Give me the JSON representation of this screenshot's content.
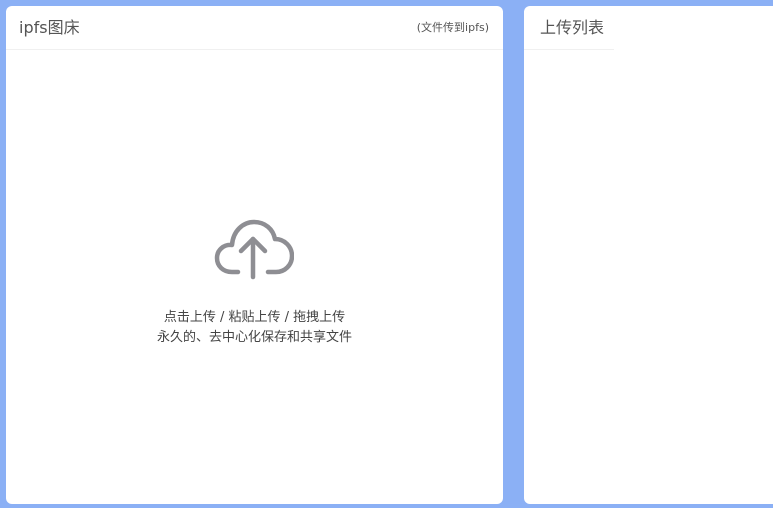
{
  "upload_panel": {
    "title": "ipfs图床",
    "note": "(文件传到ipfs)",
    "icon": "cloud-upload-icon",
    "instructions": "点击上传 / 粘贴上传 / 拖拽上传",
    "description": "永久的、去中心化保存和共享文件"
  },
  "list_panel": {
    "title": "上传列表"
  },
  "colors": {
    "background": "#8bb0f5",
    "panel": "#ffffff",
    "icon": "#8e8e93",
    "text": "#555555"
  }
}
